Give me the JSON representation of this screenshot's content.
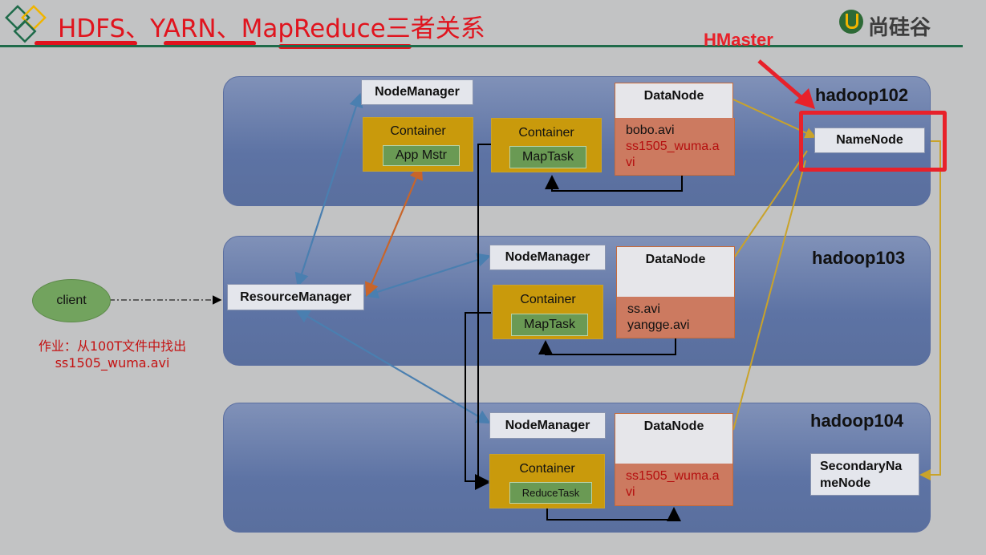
{
  "title": "HDFS、YARN、MapReduce三者关系",
  "logo_text": "尚硅谷",
  "hmaster_label": "HMaster",
  "client": {
    "label": "client"
  },
  "homework": {
    "line1": "作业：从100T文件中找出",
    "line2": "ss1505_wuma.avi"
  },
  "resource_manager": "ResourceManager",
  "colors": {
    "title_red": "#e0141e",
    "hdfs_link": "#c9a32a",
    "yarn_link": "#4a7fb0",
    "am_link": "#c8652a",
    "mr_link": "#000000",
    "band": "#6b7fae",
    "container": "#c99a0c",
    "task": "#6a9a54",
    "datanode_body": "#cc7a60"
  },
  "hosts": [
    {
      "name": "hadoop102",
      "node_manager": "NodeManager",
      "containers": [
        {
          "label": "Container",
          "task": "App Mstr"
        },
        {
          "label": "Container",
          "task": "MapTask"
        }
      ],
      "datanode": {
        "label": "DataNode",
        "files": [
          {
            "text": "bobo.avi",
            "color": "black"
          },
          {
            "text": "ss1505_wuma.a",
            "color": "red"
          },
          {
            "text": "vi",
            "color": "red"
          }
        ]
      },
      "namenode": "NameNode"
    },
    {
      "name": "hadoop103",
      "node_manager": "NodeManager",
      "containers": [
        {
          "label": "Container",
          "task": "MapTask"
        }
      ],
      "datanode": {
        "label": "DataNode",
        "files": [
          {
            "text": "ss.avi",
            "color": "black"
          },
          {
            "text": "yangge.avi",
            "color": "black"
          }
        ]
      }
    },
    {
      "name": "hadoop104",
      "node_manager": "NodeManager",
      "containers": [
        {
          "label": "Container",
          "task": "ReduceTask"
        }
      ],
      "datanode": {
        "label": "DataNode",
        "files": [
          {
            "text": "ss1505_wuma.a",
            "color": "red"
          },
          {
            "text": "vi",
            "color": "red"
          }
        ]
      },
      "secondary_namenode": {
        "line1": "SecondaryNa",
        "line2": "meNode"
      }
    }
  ]
}
